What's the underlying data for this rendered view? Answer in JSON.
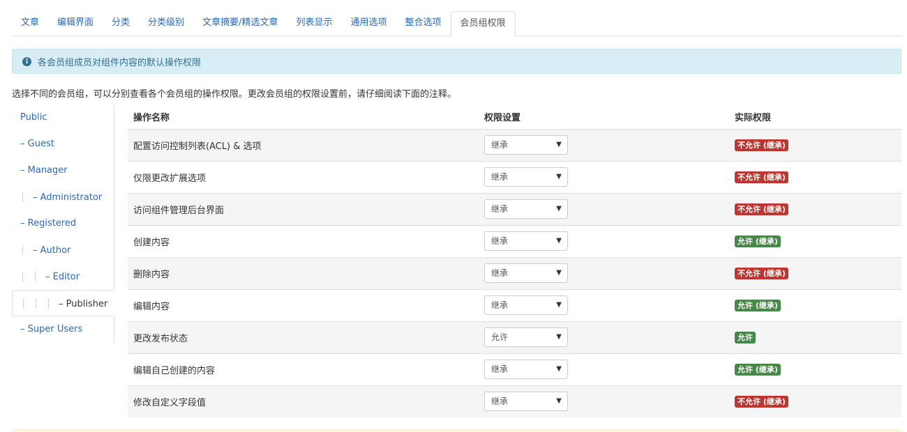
{
  "tabs": [
    {
      "label": "文章"
    },
    {
      "label": "编辑界面"
    },
    {
      "label": "分类"
    },
    {
      "label": "分类级别"
    },
    {
      "label": "文章摘要/精选文章"
    },
    {
      "label": "列表显示"
    },
    {
      "label": "通用选项"
    },
    {
      "label": "整合选项"
    },
    {
      "label": "会员组权限",
      "active": true
    }
  ],
  "alert": {
    "text": "各会员组成员对组件内容的默认操作权限"
  },
  "description": "选择不同的会员组，可以分别查看各个会员组的操作权限。更改会员组的权限设置前，请仔细阅读下面的注释。",
  "groups": [
    {
      "label": "Public",
      "depth": 0
    },
    {
      "label": "– Guest",
      "depth": 0
    },
    {
      "label": "– Manager",
      "depth": 0
    },
    {
      "label": "– Administrator",
      "depth": 1
    },
    {
      "label": "– Registered",
      "depth": 0
    },
    {
      "label": "– Author",
      "depth": 1
    },
    {
      "label": "– Editor",
      "depth": 2
    },
    {
      "label": "– Publisher",
      "depth": 3,
      "active": true
    },
    {
      "label": "– Super Users",
      "depth": 0
    }
  ],
  "table": {
    "headers": {
      "action": "操作名称",
      "setting": "权限设置",
      "actual": "实际权限"
    },
    "rows": [
      {
        "action": "配置访问控制列表(ACL) & 选项",
        "setting": "继承",
        "actual": "不允许 (继承)",
        "status": "deny"
      },
      {
        "action": "仅限更改扩展选项",
        "setting": "继承",
        "actual": "不允许 (继承)",
        "status": "deny"
      },
      {
        "action": "访问组件管理后台界面",
        "setting": "继承",
        "actual": "不允许 (继承)",
        "status": "deny"
      },
      {
        "action": "创建内容",
        "setting": "继承",
        "actual": "允许 (继承)",
        "status": "allow"
      },
      {
        "action": "删除内容",
        "setting": "继承",
        "actual": "不允许 (继承)",
        "status": "deny"
      },
      {
        "action": "编辑内容",
        "setting": "继承",
        "actual": "允许 (继承)",
        "status": "allow"
      },
      {
        "action": "更改发布状态",
        "setting": "允许",
        "actual": "允许",
        "status": "allow"
      },
      {
        "action": "编辑自己创建的内容",
        "setting": "继承",
        "actual": "允许 (继承)",
        "status": "allow"
      },
      {
        "action": "修改自定义字段值",
        "setting": "继承",
        "actual": "不允许 (继承)",
        "status": "deny"
      }
    ]
  },
  "icons": {
    "info": "info-icon",
    "select_arrow": "caret-down-icon",
    "tree_guide": "tree-guide-icon"
  },
  "colors": {
    "link": "#2a69b8",
    "deny": "#bd362f",
    "allow": "#468847",
    "info_bg": "#d9edf7"
  }
}
